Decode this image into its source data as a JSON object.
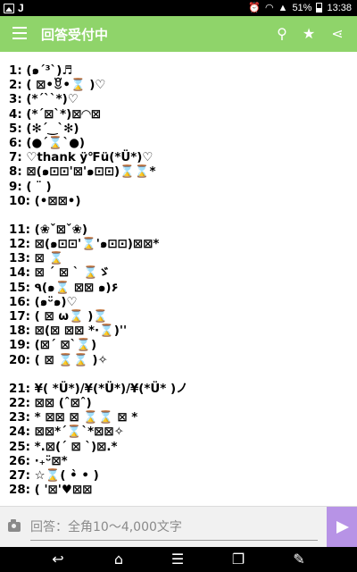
{
  "status_bar": {
    "battery": "51%",
    "time": "13:38",
    "carrier_letter": "J",
    "icons": [
      "image-icon",
      "alarm-icon",
      "wifi-icon",
      "signal-icon",
      "battery-icon"
    ]
  },
  "app_bar": {
    "title": "回答受付中",
    "icons": [
      "menu-icon",
      "search-icon",
      "star-icon",
      "share-icon"
    ],
    "color": "#8fd46a"
  },
  "answers": {
    "group1": [
      {
        "n": "1:",
        "t": "(๑ˊ³ˋ)♬"
      },
      {
        "n": "2:",
        "t": "( ⊠•ꆚ•⌛ )♡"
      },
      {
        "n": "3:",
        "t": "(*´``*)♡"
      },
      {
        "n": "4:",
        "t": "(*´⊠`*)⊠◠⊠"
      },
      {
        "n": "5:",
        "t": "(✻´‿`✻)"
      },
      {
        "n": "6:",
        "t": "(●´⌛`●)"
      },
      {
        "n": "7:",
        "t": "♡thank ÿ℉ü(*Ü*)♡"
      },
      {
        "n": "8:",
        "t": "⊠(๑⊡⊡'⊠'๑⊡⊡)⌛⌛*"
      },
      {
        "n": "9:",
        "t": "( ¨ )"
      },
      {
        "n": "10:",
        "t": "(•⊠⊠•)"
      }
    ],
    "group2": [
      {
        "n": "11:",
        "t": "(❀ˇ⊠ˇ❀)"
      },
      {
        "n": "12:",
        "t": "⊠(๑⊡⊡'⌛'๑⊡⊡)⊠⊠*"
      },
      {
        "n": "13:",
        "t": "⊠ ⌛"
      },
      {
        "n": "14:",
        "t": "⊠ ´ ⊠ ` ⌛ゞ"
      },
      {
        "n": "15:",
        "t": "٩(๑⌛ ⊠⊠ ๑)۶"
      },
      {
        "n": "16:",
        "t": "(๑ᵕ̈๑)♡"
      },
      {
        "n": "17:",
        "t": "( ⊠ ω⌛ )⌛"
      },
      {
        "n": "18:",
        "t": "⊠(⊠ ⊠⊠ *·⌛)''"
      },
      {
        "n": "19:",
        "t": "(⊠´  ⊠`⌛)"
      },
      {
        "n": "20:",
        "t": "( ⊠ ⌛⌛ )✧"
      }
    ],
    "group3": [
      {
        "n": "21:",
        "t": "¥( *Ü*)/¥(*Ü*)/¥(*Ü* )ノ"
      },
      {
        "n": "22:",
        "t": "⊠⊠ (ˆ⊠ˆ)"
      },
      {
        "n": "23:",
        "t": "* ⊠⊠ ⊠ ⌛⌛ ⊠ *"
      },
      {
        "n": "24:",
        "t": "⊠⊠*´⌛`*⊠⊠✧"
      },
      {
        "n": "25:",
        "t": "*.⊠(ˊ ⊠ ˋ)⊠.*"
      },
      {
        "n": "26:",
        "t": "·₊ᵕ̈⊠*"
      },
      {
        "n": "27:",
        "t": "☆⌛( •̀ • )"
      },
      {
        "n": "28:",
        "t": "( '⊠'♥⊠⊠"
      }
    ]
  },
  "input_bar": {
    "placeholder": "回答：全角10〜4,000文字",
    "icons": [
      "camera-icon",
      "send-icon"
    ],
    "send_color": "#b793e6"
  },
  "nav_bar": {
    "icons": [
      "back-icon",
      "home-icon",
      "menu-icon",
      "recent-apps-icon",
      "edit-icon"
    ]
  }
}
